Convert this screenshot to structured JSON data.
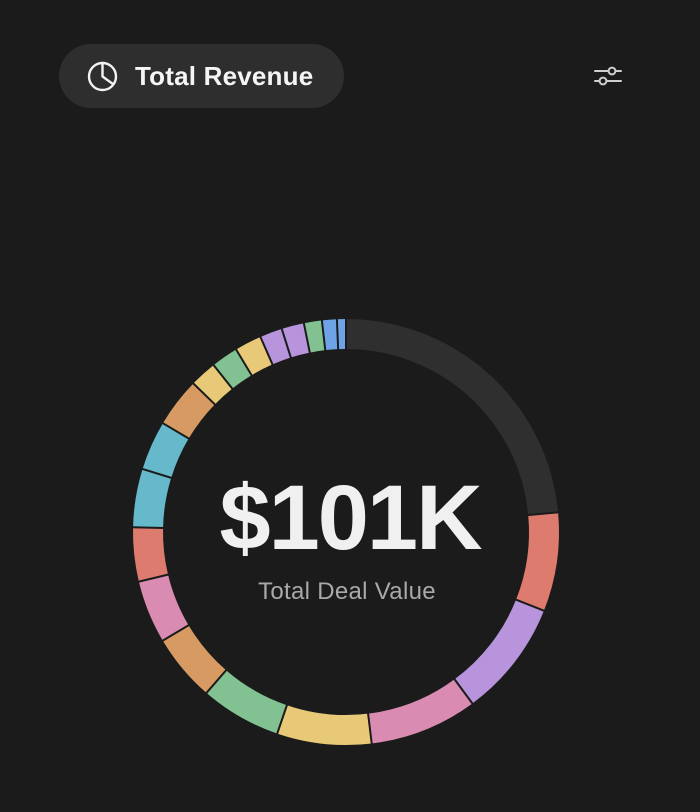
{
  "header": {
    "title": "Total Revenue",
    "title_icon": "pie-chart-icon",
    "filter_icon": "sliders-icon"
  },
  "chart_data": {
    "type": "pie",
    "style": "donut",
    "center_value": "$101K",
    "center_label": "Total Deal Value",
    "total_revenue_k": 101,
    "track_color": "#2f2f2f",
    "separator_color": "#1b1b1b",
    "slices": [
      {
        "value": 2.2,
        "color": "#dd7b6e"
      },
      {
        "value": 2.6,
        "color": "#b794dc"
      },
      {
        "value": 2.4,
        "color": "#d98bb2"
      },
      {
        "value": 2.1,
        "color": "#e8c977"
      },
      {
        "value": 1.8,
        "color": "#82c191"
      },
      {
        "value": 1.5,
        "color": "#d89a63"
      },
      {
        "value": 1.4,
        "color": "#d98bb2"
      },
      {
        "value": 1.2,
        "color": "#dd7b6e"
      },
      {
        "value": 1.3,
        "color": "#66b8cb"
      },
      {
        "value": 1.1,
        "color": "#66b8cb"
      },
      {
        "value": 1.1,
        "color": "#d89a63"
      },
      {
        "value": 0.6,
        "color": "#e8c977"
      },
      {
        "value": 0.6,
        "color": "#82c191"
      },
      {
        "value": 0.6,
        "color": "#e8c977"
      },
      {
        "value": 0.5,
        "color": "#b794dc"
      },
      {
        "value": 0.5,
        "color": "#b794dc"
      },
      {
        "value": 0.4,
        "color": "#82c191"
      },
      {
        "value": 0.33,
        "color": "#6fa3e8"
      },
      {
        "value": 0.2,
        "color": "#6fa3e8"
      }
    ],
    "remaining": {
      "value": 6.9,
      "color": "#2f2f2f"
    }
  }
}
